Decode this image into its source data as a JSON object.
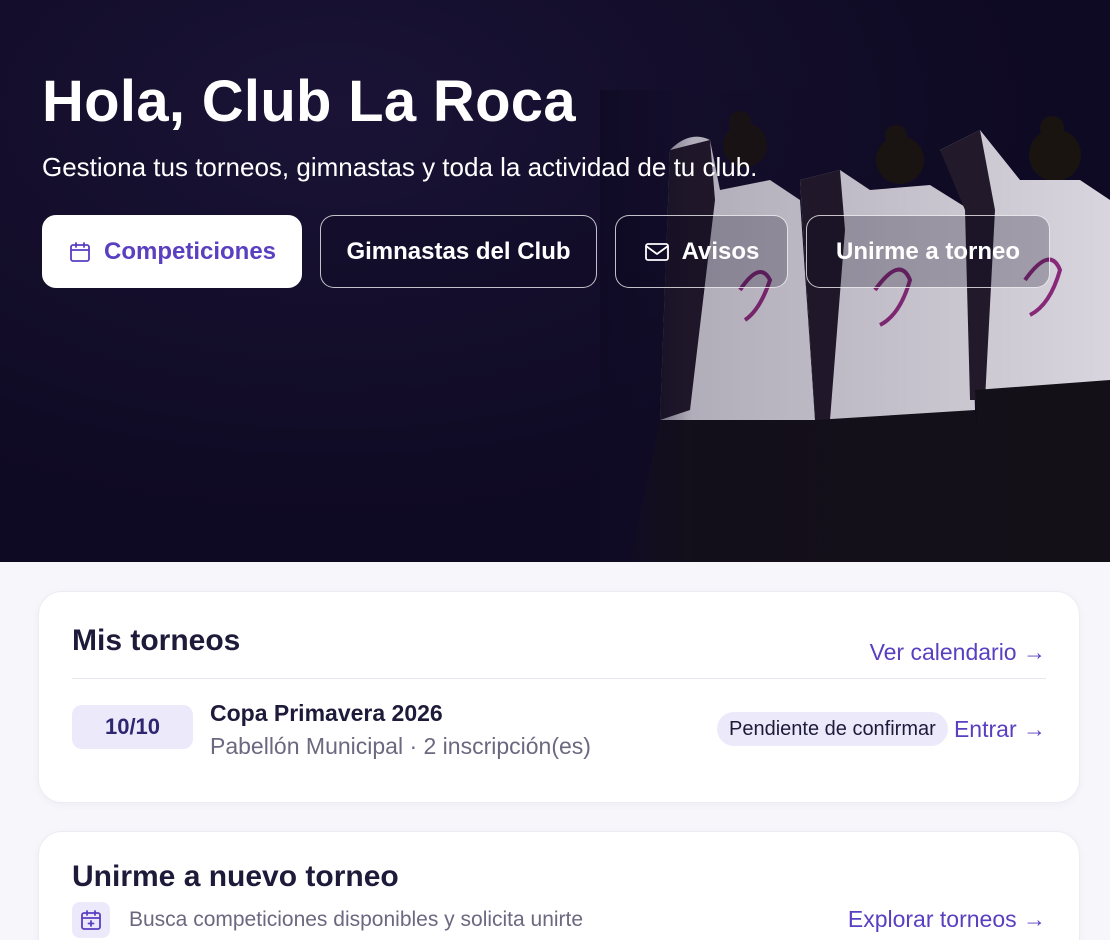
{
  "hero": {
    "title": "Hola, Club La Roca",
    "subtitle": "Gestiona tus torneos, gimnastas y toda la actividad de tu club.",
    "actions": [
      {
        "label": "Competiciones",
        "icon": "calendar-icon"
      },
      {
        "label": "Gimnastas del Club"
      },
      {
        "label": "Avisos",
        "icon": "mail-icon"
      },
      {
        "label": "Unirme a torneo"
      }
    ]
  },
  "my_tournaments": {
    "title": "Mis torneos",
    "calendar_link": "Ver calendario →",
    "items": [
      {
        "date": "10/10",
        "name": "Copa Primavera 2026",
        "meta": "Pabellón Municipal · 2 inscripción(es)",
        "status": "Pendiente de confirmar",
        "action": "Entrar →"
      }
    ]
  },
  "join": {
    "title": "Unirme a nuevo torneo",
    "description": "Busca competiciones disponibles y solicita unirte",
    "link": "Explorar torneos →",
    "icon": "calendar-add-icon"
  },
  "colors": {
    "accent": "#5a3fc0",
    "hero_bg": "#100b25",
    "badge_bg": "#ece9fb"
  }
}
